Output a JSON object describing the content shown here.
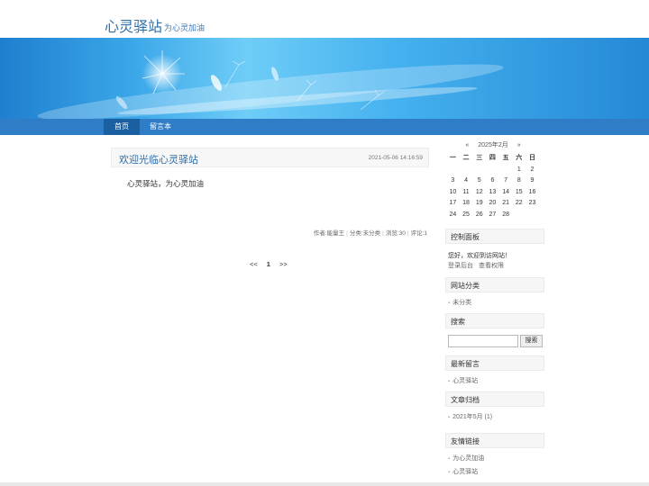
{
  "site": {
    "title": "心灵驿站",
    "subtitle": "为心灵加油"
  },
  "nav": {
    "items": [
      "首页",
      "留言本"
    ]
  },
  "post": {
    "title": "欢迎光临心灵驿站",
    "date": "2021-05-06 14:16:59",
    "body": "心灵驿站，为心灵加油",
    "meta": {
      "author": "作者:能量王",
      "category": "分类:未分类",
      "views": "浏览:30",
      "comments": "评论:1"
    }
  },
  "pager": {
    "prev": "<<",
    "current": "1",
    "next": ">>"
  },
  "calendar": {
    "prev": "«",
    "month": "2025年2月",
    "next": "»",
    "weekdays": [
      "一",
      "二",
      "三",
      "四",
      "五",
      "六",
      "日"
    ],
    "days": [
      "",
      "",
      "",
      "",
      "",
      "1",
      "2",
      "3",
      "4",
      "5",
      "6",
      "7",
      "8",
      "9",
      "10",
      "11",
      "12",
      "13",
      "14",
      "15",
      "16",
      "17",
      "18",
      "19",
      "20",
      "21",
      "22",
      "23",
      "24",
      "25",
      "26",
      "27",
      "28",
      "",
      ""
    ]
  },
  "sidebar": {
    "control": {
      "title": "控制面板",
      "welcome": "您好，欢迎到访网站！",
      "login": "登录后台",
      "permissions": "查看权限"
    },
    "categories": {
      "title": "网站分类",
      "items": [
        "未分类"
      ]
    },
    "search": {
      "title": "搜索",
      "button": "搜索",
      "value": ""
    },
    "comments": {
      "title": "最新留言",
      "items": [
        "心灵驿站"
      ]
    },
    "archive": {
      "title": "文章归档",
      "items": [
        "2021年5月 (1)"
      ]
    },
    "links": {
      "title": "友情链接",
      "items": [
        "为心灵加油",
        "心灵驿站"
      ]
    }
  },
  "colors": {
    "accent": "#2f6fa8",
    "nav": "#2f7dc7",
    "nav_active": "#1a5f9f"
  }
}
